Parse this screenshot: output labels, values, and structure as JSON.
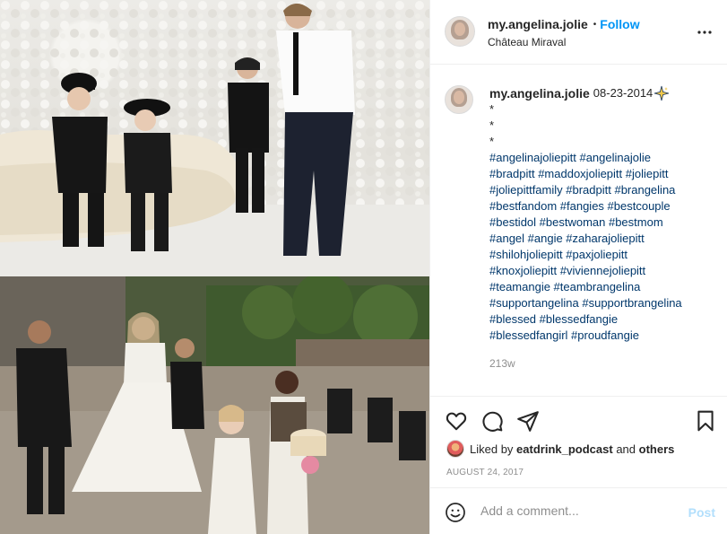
{
  "header": {
    "username": "my.angelina.jolie",
    "separator": "•",
    "follow_label": "Follow",
    "location": "Château Miraval"
  },
  "caption": {
    "username": "my.angelina.jolie",
    "date_text": "08-23-2014",
    "emoji_icon": "sparkle-emoji",
    "star_lines": [
      "*",
      "*",
      "*"
    ],
    "hashtags": [
      "#angelinajoliepitt #angelinajolie",
      "#bradpitt #maddoxjoliepitt #joliepitt",
      "#joliepittfamily #bradpitt #brangelina",
      "#bestfandom #fangies #bestcouple",
      "#bestidol #bestwoman #bestmom",
      "#angel #angie #zaharajoliepitt",
      "#shilohjoliepitt #paxjoliepitt",
      "#knoxjoliepitt #viviennejoliepitt",
      "#teamangie #teambrangelina",
      "#supportangelina #supportbrangelina",
      "#blessed #blessedfangie",
      "#blessedfangirl #proudfangie"
    ],
    "time_ago": "213w"
  },
  "actions": {
    "icons": [
      "heart-icon",
      "comment-icon",
      "share-icon",
      "bookmark-icon"
    ],
    "liked_by_prefix": "Liked by ",
    "liked_by_user": "eatdrink_podcast",
    "liked_by_and": " and ",
    "liked_by_others": "others",
    "date": "AUGUST 24, 2017"
  },
  "comment": {
    "placeholder": "Add a comment...",
    "post_label": "Post"
  },
  "colors": {
    "link_blue": "#0095f6",
    "hashtag": "#00376b",
    "muted": "#8e8e8e",
    "post_disabled": "#b2dffc"
  }
}
